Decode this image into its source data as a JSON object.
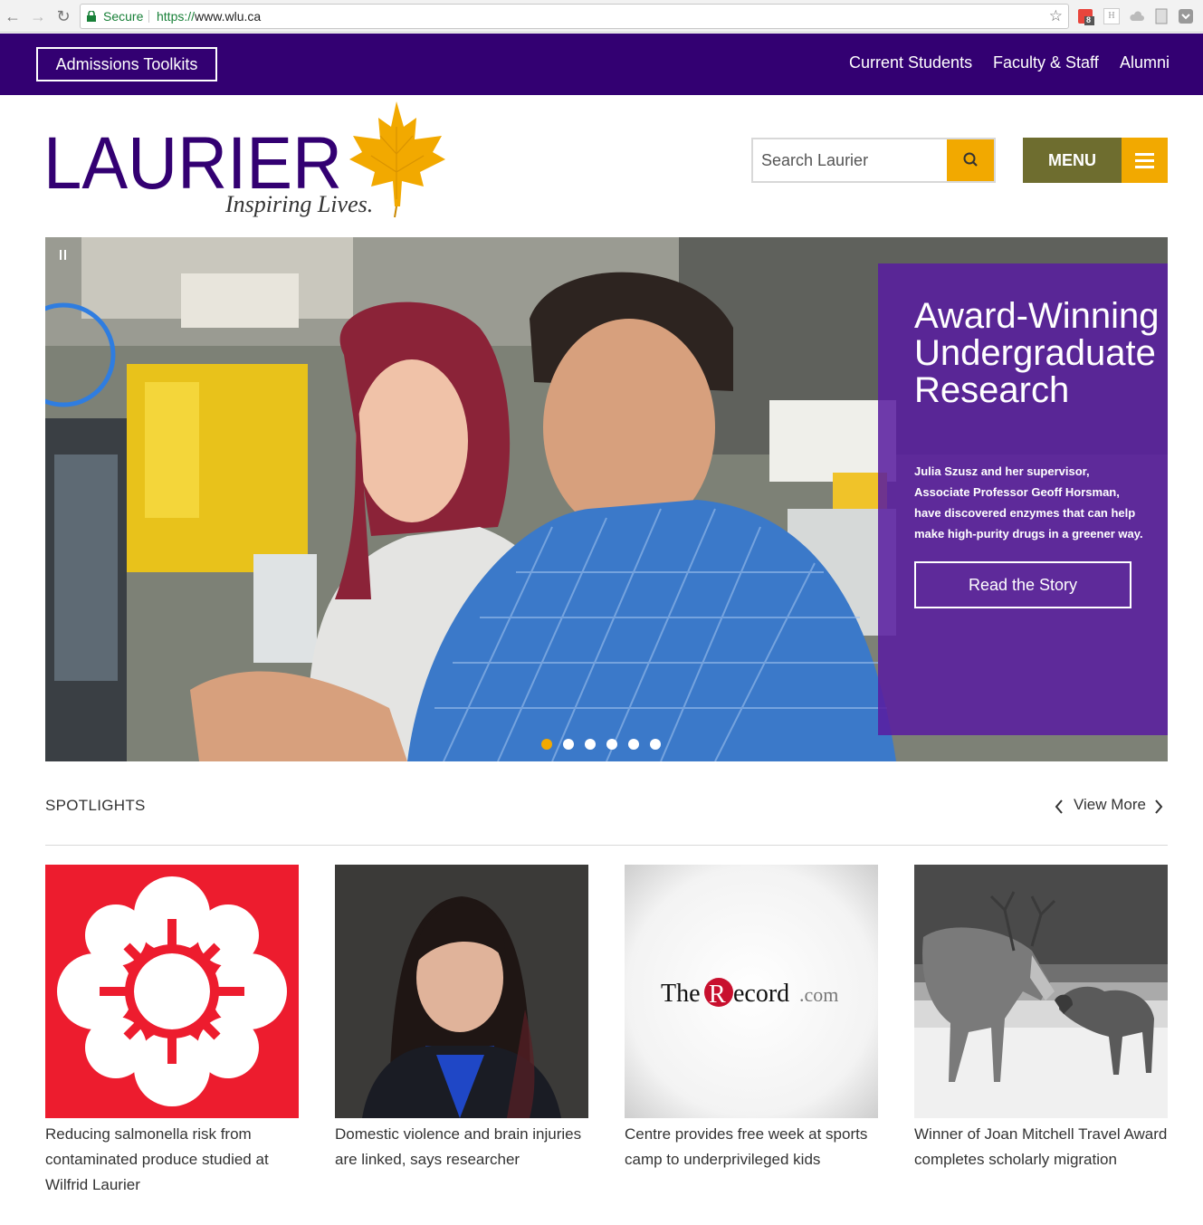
{
  "browser": {
    "secure_label": "Secure",
    "url_scheme": "https://",
    "url_host": "www.wlu.ca",
    "extension_badge": "8",
    "extension_letter": "H"
  },
  "topbar": {
    "admissions_label": "Admissions Toolkits",
    "links": [
      "Current Students",
      "Faculty & Staff",
      "Alumni"
    ]
  },
  "header": {
    "logo_text": "LAURIER",
    "tagline": "Inspiring Lives.",
    "search_placeholder": "Search Laurier",
    "menu_label": "MENU"
  },
  "hero": {
    "title": "Award-Winning Undergraduate Research",
    "text": "Julia Szusz and her supervisor, Associate Professor Geoff Horsman, have discovered enzymes that can help make high-purity drugs in a greener way.",
    "cta": "Read the Story",
    "slide_count": 6,
    "active_slide": 1
  },
  "spotlights": {
    "title": "SPOTLIGHTS",
    "view_more": "View More",
    "items": [
      {
        "caption": "Reducing salmonella risk from contaminated produce studied at Wilfrid Laurier"
      },
      {
        "caption": "Domestic violence and brain injuries are linked, says researcher"
      },
      {
        "caption": "Centre provides free week at sports camp to underprivileged kids",
        "thumb_text_1": "The",
        "thumb_text_2": "R",
        "thumb_text_3": "ecord",
        "thumb_text_4": ".com"
      },
      {
        "caption": "Winner of Joan Mitchell Travel Award completes scholarly migration"
      }
    ]
  },
  "colors": {
    "purple": "#330072",
    "gold": "#f2a900",
    "olive": "#6e6d2f",
    "cbc_red": "#ed1c2e"
  }
}
